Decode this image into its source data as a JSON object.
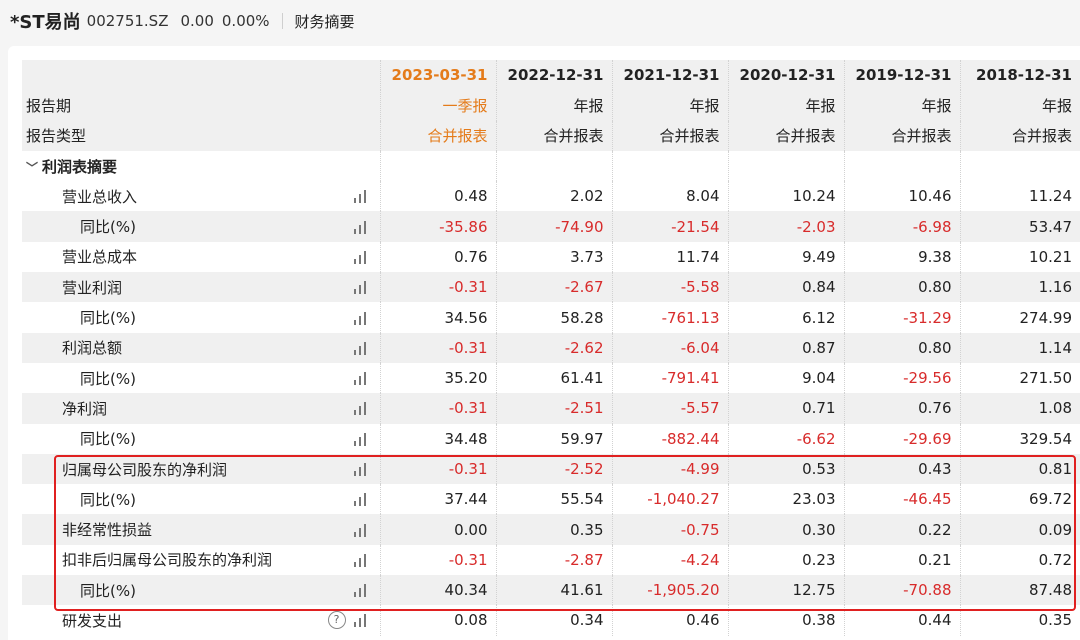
{
  "header": {
    "stock_name": "*ST易尚",
    "stock_code": "002751.SZ",
    "price": "0.00",
    "change_pct": "0.00%",
    "section": "财务摘要"
  },
  "table": {
    "period_label": "报告期",
    "type_label": "报告类型",
    "dates": [
      "2023-03-31",
      "2022-12-31",
      "2021-12-31",
      "2020-12-31",
      "2019-12-31",
      "2018-12-31"
    ],
    "periods": [
      "一季报",
      "年报",
      "年报",
      "年报",
      "年报",
      "年报"
    ],
    "types": [
      "合并报表",
      "合并报表",
      "合并报表",
      "合并报表",
      "合并报表",
      "合并报表"
    ],
    "section_title": "利润表摘要",
    "rows": [
      {
        "label": "营业总收入",
        "values": [
          "0.48",
          "2.02",
          "8.04",
          "10.24",
          "10.46",
          "11.24"
        ]
      },
      {
        "label": "同比(%)",
        "values": [
          "-35.86",
          "-74.90",
          "-21.54",
          "-2.03",
          "-6.98",
          "53.47"
        ]
      },
      {
        "label": "营业总成本",
        "values": [
          "0.76",
          "3.73",
          "11.74",
          "9.49",
          "9.38",
          "10.21"
        ]
      },
      {
        "label": "营业利润",
        "values": [
          "-0.31",
          "-2.67",
          "-5.58",
          "0.84",
          "0.80",
          "1.16"
        ]
      },
      {
        "label": "同比(%)",
        "values": [
          "34.56",
          "58.28",
          "-761.13",
          "6.12",
          "-31.29",
          "274.99"
        ]
      },
      {
        "label": "利润总额",
        "values": [
          "-0.31",
          "-2.62",
          "-6.04",
          "0.87",
          "0.80",
          "1.14"
        ]
      },
      {
        "label": "同比(%)",
        "values": [
          "35.20",
          "61.41",
          "-791.41",
          "9.04",
          "-29.56",
          "271.50"
        ]
      },
      {
        "label": "净利润",
        "values": [
          "-0.31",
          "-2.51",
          "-5.57",
          "0.71",
          "0.76",
          "1.08"
        ]
      },
      {
        "label": "同比(%)",
        "values": [
          "34.48",
          "59.97",
          "-882.44",
          "-6.62",
          "-29.69",
          "329.54"
        ]
      },
      {
        "label": "归属母公司股东的净利润",
        "values": [
          "-0.31",
          "-2.52",
          "-4.99",
          "0.53",
          "0.43",
          "0.81"
        ]
      },
      {
        "label": "同比(%)",
        "values": [
          "37.44",
          "55.54",
          "-1,040.27",
          "23.03",
          "-46.45",
          "69.72"
        ]
      },
      {
        "label": "非经常性损益",
        "values": [
          "0.00",
          "0.35",
          "-0.75",
          "0.30",
          "0.22",
          "0.09"
        ]
      },
      {
        "label": "扣非后归属母公司股东的净利润",
        "values": [
          "-0.31",
          "-2.87",
          "-4.24",
          "0.23",
          "0.21",
          "0.72"
        ]
      },
      {
        "label": "同比(%)",
        "values": [
          "40.34",
          "41.61",
          "-1,905.20",
          "12.75",
          "-70.88",
          "87.48"
        ]
      },
      {
        "label": "研发支出",
        "values": [
          "0.08",
          "0.34",
          "0.46",
          "0.38",
          "0.44",
          "0.35"
        ]
      }
    ],
    "help_symbol": "?"
  },
  "colors": {
    "negative": "#d82b2b",
    "highlight_column": "#e47b1a",
    "annotation_box": "#e02020"
  }
}
